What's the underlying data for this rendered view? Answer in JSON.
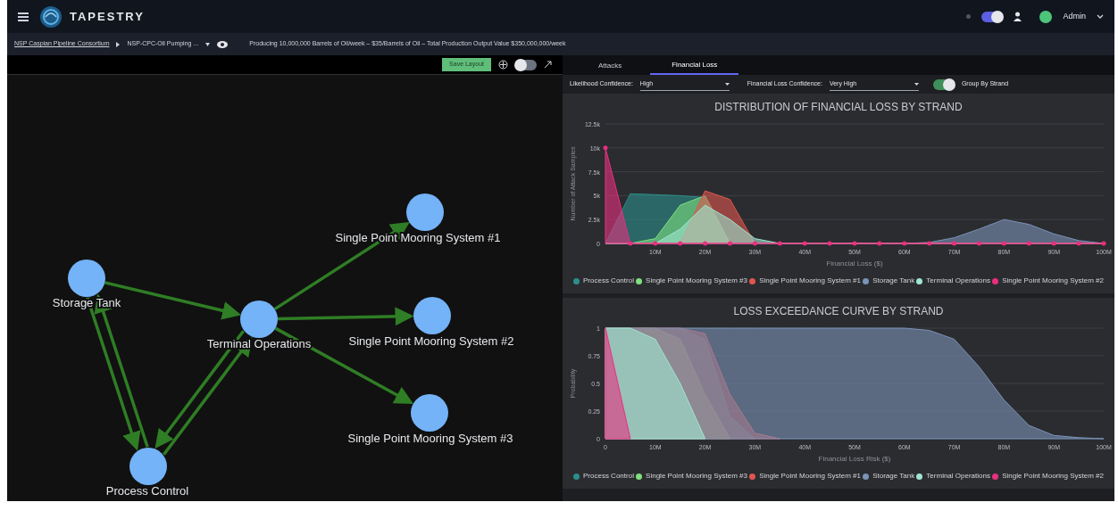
{
  "header": {
    "app_name": "TAPESTRY",
    "user": "Admin",
    "theme_toggle_on": true
  },
  "breadcrumb": {
    "organization": "NSP Caspian Pipeline Consortium",
    "asset": "NSP-CPC-Oil Pumping ...",
    "summary": "Producing 10,000,000 Barrels of Oil/week – $35/Barrels of Oil – Total Production Output Value $350,000,000/week"
  },
  "graph_toolbar": {
    "save_button": "Save Layout",
    "toggle_on": false
  },
  "graph": {
    "nodes": [
      {
        "label": "Storage Tank"
      },
      {
        "label": "Terminal Operations"
      },
      {
        "label": "Single Point Mooring System #1"
      },
      {
        "label": "Single Point Mooring System #2"
      },
      {
        "label": "Single Point Mooring System #3"
      },
      {
        "label": "Process Control"
      }
    ]
  },
  "tabs": [
    {
      "label": "Attacks",
      "selected": false
    },
    {
      "label": "Financial Loss",
      "selected": true
    }
  ],
  "filters": {
    "likelihood_label": "Likelihood Confidence:",
    "likelihood_value": "High",
    "loss_label": "Financial Loss Confidence:",
    "loss_value": "Very High",
    "group_label": "Group By Strand",
    "group_on": true
  },
  "charts": [
    {
      "chart_data": {
        "type": "area",
        "title": "DISTRIBUTION OF FINANCIAL LOSS BY STRAND",
        "xlabel": "Financial Loss ($)",
        "ylabel": "Number of Attack Samples",
        "x": [
          0,
          5,
          10,
          15,
          20,
          25,
          30,
          35,
          40,
          45,
          50,
          55,
          60,
          65,
          70,
          75,
          80,
          85,
          90,
          95,
          100
        ],
        "xlim": [
          0,
          100
        ],
        "ylim": [
          0,
          12500
        ],
        "grid": true,
        "xticks": [
          {
            "value": 10,
            "label": "10M"
          },
          {
            "value": 20,
            "label": "20M"
          },
          {
            "value": 30,
            "label": "30M"
          },
          {
            "value": 40,
            "label": "40M"
          },
          {
            "value": 50,
            "label": "50M"
          },
          {
            "value": 60,
            "label": "60M"
          },
          {
            "value": 70,
            "label": "70M"
          },
          {
            "value": 80,
            "label": "80M"
          },
          {
            "value": 90,
            "label": "90M"
          },
          {
            "value": 100,
            "label": "100M"
          }
        ],
        "yticks": [
          {
            "value": 0,
            "label": "0"
          },
          {
            "value": 2500,
            "label": "2.5k"
          },
          {
            "value": 5000,
            "label": "5k"
          },
          {
            "value": 7500,
            "label": "7.5k"
          },
          {
            "value": 10000,
            "label": "10k"
          },
          {
            "value": 12500,
            "label": "12.5k"
          }
        ],
        "series": [
          {
            "name": "Process Control",
            "color": "#2a8f8a",
            "values": [
              0,
              5200,
              5100,
              5000,
              4800,
              0,
              0,
              0,
              0,
              0,
              0,
              0,
              0,
              0,
              0,
              0,
              0,
              0,
              0,
              0,
              0
            ]
          },
          {
            "name": "Single Point Mooring System #3",
            "color": "#7ee07e",
            "values": [
              0,
              0,
              500,
              4000,
              5000,
              0,
              0,
              0,
              0,
              0,
              0,
              0,
              0,
              0,
              0,
              0,
              0,
              0,
              0,
              0,
              0
            ]
          },
          {
            "name": "Single Point Mooring System #1",
            "color": "#e0564f",
            "values": [
              0,
              0,
              0,
              0,
              5500,
              4600,
              0,
              0,
              0,
              0,
              0,
              0,
              0,
              0,
              0,
              0,
              0,
              0,
              0,
              0,
              0
            ]
          },
          {
            "name": "Storage Tank",
            "color": "#7b93b8",
            "values": [
              0,
              0,
              0,
              0,
              0,
              0,
              0,
              0,
              0,
              0,
              0,
              0,
              0,
              100,
              600,
              1500,
              2500,
              2000,
              1000,
              300,
              0
            ]
          },
          {
            "name": "Terminal Operations",
            "color": "#9fe6d0",
            "values": [
              0,
              0,
              0,
              1500,
              4000,
              2500,
              500,
              0,
              0,
              0,
              0,
              0,
              0,
              0,
              0,
              0,
              0,
              0,
              0,
              0,
              0
            ]
          },
          {
            "name": "Single Point Mooring System #2",
            "color": "#e8307f",
            "values": [
              10000,
              0,
              0,
              0,
              0,
              0,
              0,
              0,
              0,
              0,
              0,
              0,
              0,
              0,
              0,
              0,
              0,
              0,
              0,
              0,
              0
            ]
          }
        ]
      }
    },
    {
      "chart_data": {
        "type": "area",
        "title": "LOSS EXCEEDANCE CURVE BY STRAND",
        "xlabel": "Financial Loss Risk ($)",
        "ylabel": "Probability",
        "x": [
          0,
          5,
          10,
          15,
          20,
          25,
          30,
          35,
          40,
          45,
          50,
          55,
          60,
          65,
          70,
          75,
          80,
          85,
          90,
          95,
          100
        ],
        "xlim": [
          0,
          100
        ],
        "ylim": [
          0,
          1
        ],
        "grid": true,
        "xticks": [
          {
            "value": 0,
            "label": "0"
          },
          {
            "value": 10,
            "label": "10M"
          },
          {
            "value": 20,
            "label": "20M"
          },
          {
            "value": 30,
            "label": "30M"
          },
          {
            "value": 40,
            "label": "40M"
          },
          {
            "value": 50,
            "label": "50M"
          },
          {
            "value": 60,
            "label": "60M"
          },
          {
            "value": 70,
            "label": "70M"
          },
          {
            "value": 80,
            "label": "80M"
          },
          {
            "value": 90,
            "label": "90M"
          },
          {
            "value": 100,
            "label": "100M"
          }
        ],
        "yticks": [
          {
            "value": 0,
            "label": "0"
          },
          {
            "value": 0.25,
            "label": "0.25"
          },
          {
            "value": 0.5,
            "label": "0.5"
          },
          {
            "value": 0.75,
            "label": "0.75"
          },
          {
            "value": 1,
            "label": "1"
          }
        ],
        "series": [
          {
            "name": "Process Control",
            "color": "#2a8f8a",
            "values": [
              1,
              1,
              1,
              1,
              0.9,
              0.2,
              0,
              null,
              null,
              null,
              null,
              null,
              null,
              null,
              null,
              null,
              null,
              null,
              null,
              null,
              null
            ]
          },
          {
            "name": "Single Point Mooring System #3",
            "color": "#7ee07e",
            "values": [
              1,
              1,
              1,
              0.9,
              0.4,
              0,
              null,
              null,
              null,
              null,
              null,
              null,
              null,
              null,
              null,
              null,
              null,
              null,
              null,
              null,
              null
            ]
          },
          {
            "name": "Single Point Mooring System #1",
            "color": "#e0564f",
            "values": [
              1,
              1,
              1,
              1,
              0.95,
              0.4,
              0.05,
              0,
              null,
              null,
              null,
              null,
              null,
              null,
              null,
              null,
              null,
              null,
              null,
              null,
              null
            ]
          },
          {
            "name": "Storage Tank",
            "color": "#7b93b8",
            "values": [
              1,
              1,
              1,
              1,
              1,
              1,
              1,
              1,
              1,
              1,
              1,
              1,
              1,
              0.98,
              0.9,
              0.65,
              0.35,
              0.12,
              0.03,
              0.01,
              0
            ]
          },
          {
            "name": "Terminal Operations",
            "color": "#9fe6d0",
            "values": [
              1,
              1,
              0.9,
              0.5,
              0,
              null,
              null,
              null,
              null,
              null,
              null,
              null,
              null,
              null,
              null,
              null,
              null,
              null,
              null,
              null,
              null
            ]
          },
          {
            "name": "Single Point Mooring System #2",
            "color": "#e8307f",
            "values": [
              1,
              0,
              null,
              null,
              null,
              null,
              null,
              null,
              null,
              null,
              null,
              null,
              null,
              null,
              null,
              null,
              null,
              null,
              null,
              null,
              null
            ]
          }
        ]
      }
    }
  ]
}
